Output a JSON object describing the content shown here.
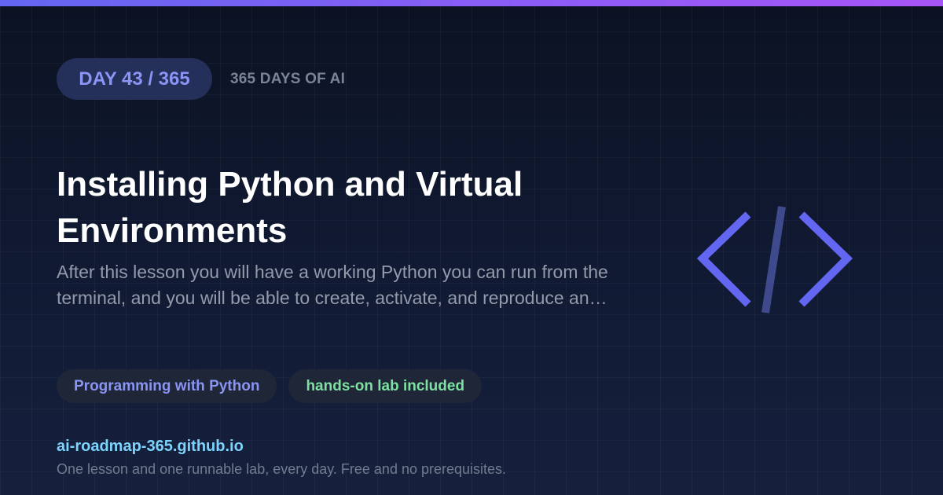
{
  "header": {
    "day_badge": "DAY 43 / 365",
    "series_label": "365 DAYS OF AI"
  },
  "lesson": {
    "title": "Installing Python and Virtual Environments",
    "description": "After this lesson you will have a working Python you can run from the terminal, and you will be able to create, activate, and reproduce an…"
  },
  "tags": {
    "topic": "Programming with Python",
    "lab": "hands-on lab included"
  },
  "footer": {
    "site": "ai-roadmap-365.github.io",
    "tagline": "One lesson and one runnable lab, every day. Free and no prerequisites."
  },
  "icon": {
    "name": "code-brackets-icon"
  },
  "colors": {
    "accent": "#6366f1",
    "accent_light": "#8a94f4",
    "lab_green": "#7ee0a1",
    "link": "#7dd3fc"
  }
}
